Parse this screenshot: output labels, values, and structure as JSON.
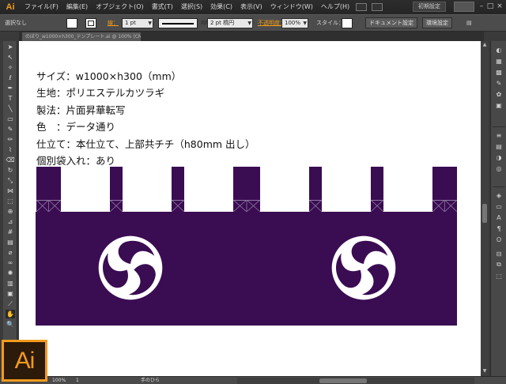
{
  "app": {
    "logo": "Ai",
    "badge": "Ai"
  },
  "menu": {
    "items": [
      "ファイル(F)",
      "編集(E)",
      "オブジェクト(O)",
      "書式(T)",
      "選択(S)",
      "効果(C)",
      "表示(V)",
      "ウィンドウ(W)",
      "ヘルプ(H)"
    ],
    "workspace": "初期設定"
  },
  "control": {
    "selection": "選択なし",
    "stroke_label": "線：",
    "stroke_weight": "1 pt",
    "profile": "均等",
    "brush": "2 pt 楕円",
    "opacity_label": "不透明度：",
    "opacity_value": "100%",
    "style_label": "スタイル：",
    "doc_setup": "ドキュメント設定",
    "preferences": "環境設定"
  },
  "document": {
    "tab_name": "のぼり_w1000×h300_テンプレート.ai @ 100% (CMYK/プレビュー)",
    "spec_lines": [
      "サイズ：w1000×h300（mm）",
      "生地：ポリエステルカツラギ",
      "製法：片面昇華転写",
      "色　：データ通り",
      "仕立て：本仕立て、上部共チチ（h80mm 出し）",
      "個別袋入れ：あり"
    ]
  },
  "status": {
    "zoom": "100%",
    "page": "1",
    "tool": "手のひら"
  },
  "colors": {
    "banner": "#3a0c52",
    "crest": "#ffffff",
    "accent": "#f29b1d"
  }
}
